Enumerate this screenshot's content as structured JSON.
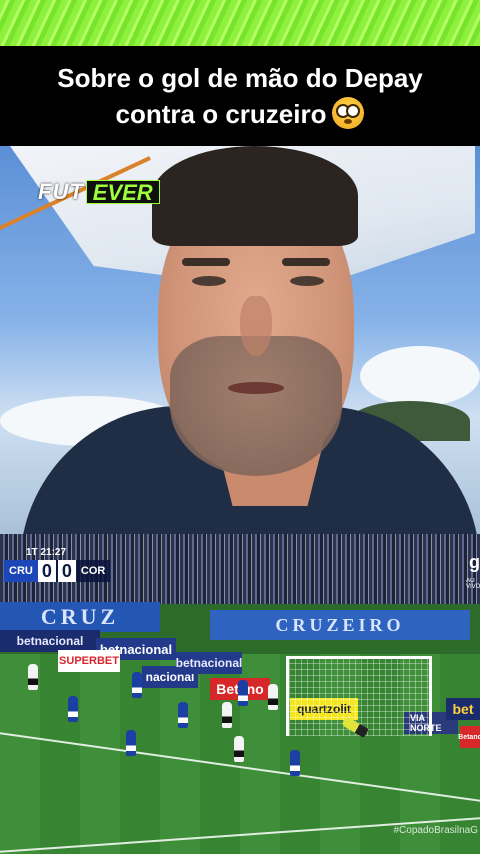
{
  "caption": {
    "line1": "Sobre o gol de mão do Depay",
    "line2": "contra o cruzeiro"
  },
  "emoji": "flushed-face-icon",
  "logo": {
    "fut": "FUT",
    "ever": "EVER"
  },
  "scoreboard": {
    "period_time": "1T 21:27",
    "home_team": "CRU",
    "home_score": "0",
    "away_score": "0",
    "away_team": "COR"
  },
  "broadcaster": {
    "mark": "g",
    "sub": "AO VIVO"
  },
  "stadium": {
    "banner_left": "CRUZ",
    "banner_right": "CRUZEIRO"
  },
  "ads": {
    "superbet": "SUPERBET",
    "betnacional_1": "betnacional",
    "betnacional_2": "betnacional",
    "nacional": "nacional",
    "betnacional_3": "betnacional",
    "betano": "Betano",
    "quartzolit": "quartzolit",
    "via_norte": "VIA NORTE",
    "bet_side": "bet",
    "betano_small": "Betano"
  },
  "watermark": "#CopadoBrasilnaG",
  "colors": {
    "accent_green": "#8df13d",
    "caption_bg": "#000000",
    "cruzeiro_blue": "#1c47b8"
  }
}
